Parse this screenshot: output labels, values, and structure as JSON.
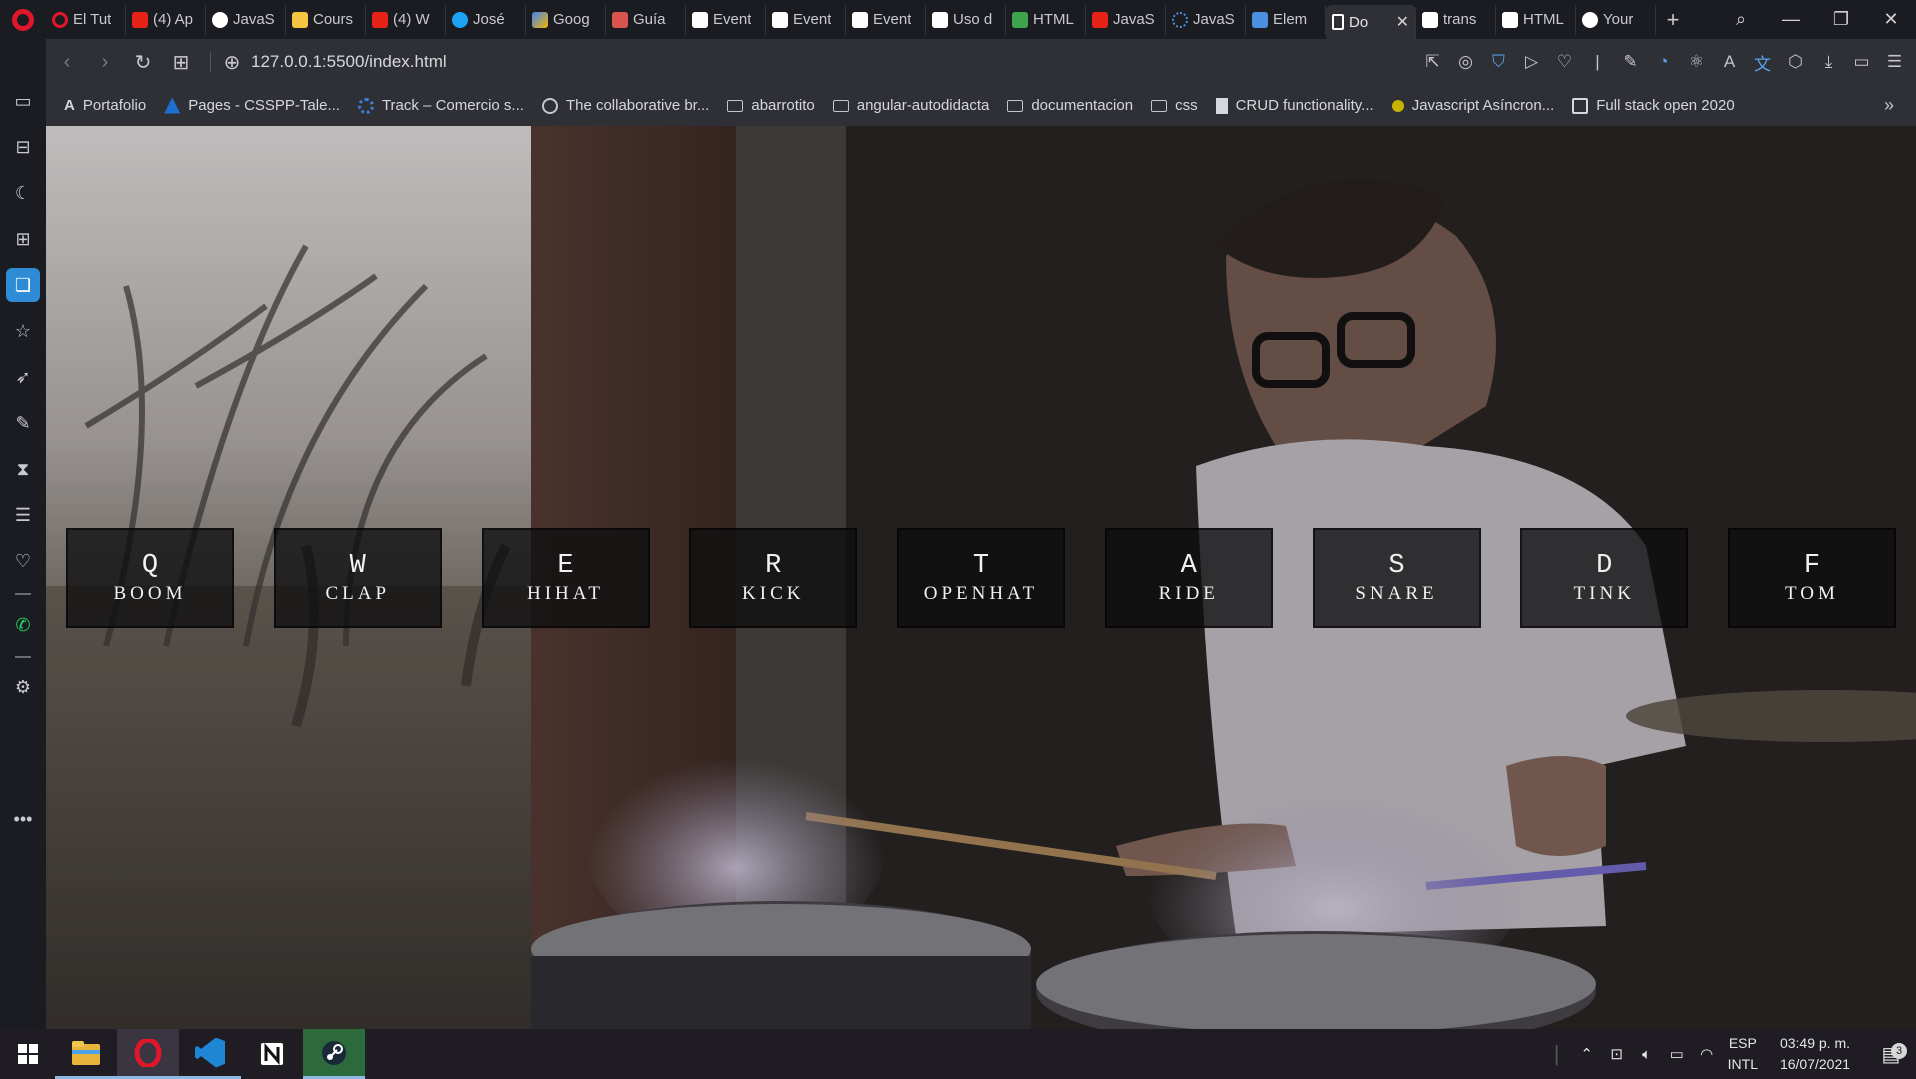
{
  "browser": {
    "tabs": [
      {
        "label": "El Tut",
        "icon": "opera-icon",
        "color": "#e0162b"
      },
      {
        "label": "(4) Ap",
        "icon": "youtube-icon",
        "color": "#e62117"
      },
      {
        "label": "JavaS",
        "icon": "github-icon",
        "color": "#ffffff"
      },
      {
        "label": "Cours",
        "icon": "course-icon",
        "color": "#f5c542"
      },
      {
        "label": "(4) W",
        "icon": "youtube-icon",
        "color": "#e62117"
      },
      {
        "label": "José",
        "icon": "twitter-icon",
        "color": "#1da1f2"
      },
      {
        "label": "Goog",
        "icon": "google-icon",
        "color": "#f4b400"
      },
      {
        "label": "Guía",
        "icon": "guide-icon",
        "color": "#d9534f"
      },
      {
        "label": "Event",
        "icon": "notion-icon",
        "color": "#ffffff"
      },
      {
        "label": "Event",
        "icon": "notion-icon",
        "color": "#ffffff"
      },
      {
        "label": "Event",
        "icon": "notion-icon",
        "color": "#ffffff"
      },
      {
        "label": "Uso d",
        "icon": "notion-icon",
        "color": "#ffffff"
      },
      {
        "label": "HTML",
        "icon": "w3-icon",
        "color": "#3fa34d"
      },
      {
        "label": "JavaS",
        "icon": "youtube-icon",
        "color": "#e62117"
      },
      {
        "label": "JavaS",
        "icon": "spinner-icon",
        "color": "#4a90d9"
      },
      {
        "label": "Elem",
        "icon": "devtools-icon",
        "color": "#4a8fe0"
      },
      {
        "label": "Do",
        "icon": "document-icon",
        "color": "#ffffff",
        "active": true
      },
      {
        "label": "trans",
        "icon": "notion-icon",
        "color": "#ffffff"
      },
      {
        "label": "HTML",
        "icon": "notion-icon",
        "color": "#ffffff"
      },
      {
        "label": "Your",
        "icon": "github-icon",
        "color": "#ffffff"
      }
    ],
    "address": {
      "url": "127.0.0.1:5500/index.html"
    },
    "bookmarks": [
      {
        "label": "Portafolio",
        "icon": "letter-a-icon"
      },
      {
        "label": "Pages - CSSPP-Tale...",
        "icon": "pages-icon"
      },
      {
        "label": "Track – Comercio s...",
        "icon": "gear-blue-icon"
      },
      {
        "label": "The collaborative br...",
        "icon": "collab-icon"
      },
      {
        "label": "abarrotito",
        "icon": "folder-icon"
      },
      {
        "label": "angular-autodidacta",
        "icon": "folder-icon"
      },
      {
        "label": "documentacion",
        "icon": "folder-icon"
      },
      {
        "label": "css",
        "icon": "folder-icon"
      },
      {
        "label": "CRUD functionality...",
        "icon": "file-icon"
      },
      {
        "label": "Javascript Asíncron...",
        "icon": "js-icon"
      },
      {
        "label": "Full stack open 2020",
        "icon": "page-icon"
      }
    ]
  },
  "drumkit": {
    "keys": [
      {
        "key": "Q",
        "sound": "boom"
      },
      {
        "key": "W",
        "sound": "clap"
      },
      {
        "key": "E",
        "sound": "hihat"
      },
      {
        "key": "R",
        "sound": "kick"
      },
      {
        "key": "T",
        "sound": "openhat"
      },
      {
        "key": "A",
        "sound": "ride"
      },
      {
        "key": "S",
        "sound": "snare"
      },
      {
        "key": "D",
        "sound": "tink"
      },
      {
        "key": "F",
        "sound": "tom"
      }
    ]
  },
  "taskbar": {
    "apps": [
      "file-explorer-icon",
      "opera-icon",
      "vscode-icon",
      "notion-icon",
      "steam-icon"
    ],
    "language": {
      "line1": "ESP",
      "line2": "INTL"
    },
    "clock": {
      "time": "03:49 p. m.",
      "date": "16/07/2021"
    },
    "notifications": "3"
  }
}
